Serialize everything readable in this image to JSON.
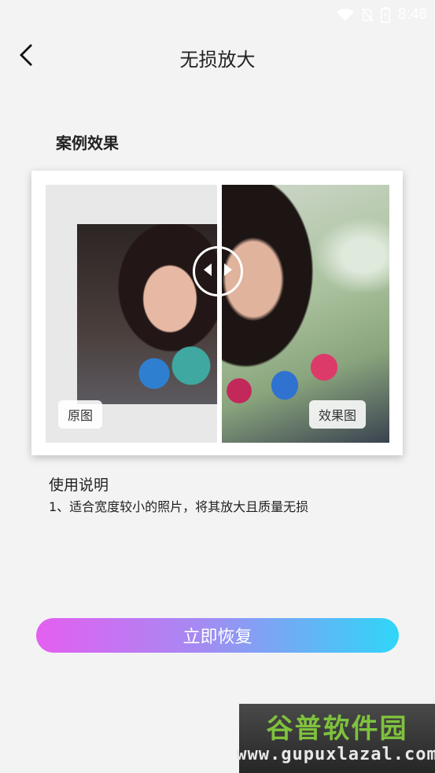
{
  "status_bar": {
    "time": "8:46",
    "icons": [
      "wifi-icon",
      "no-sim-icon",
      "battery-icon"
    ]
  },
  "header": {
    "title": "无损放大",
    "back_icon": "chevron-left-icon"
  },
  "example": {
    "section_title": "案例效果",
    "before_label": "原图",
    "after_label": "效果图",
    "handle_icon": "compare-arrows-icon"
  },
  "usage": {
    "title": "使用说明",
    "text": "1、适合宽度较小的照片，将其放大且质量无损"
  },
  "action": {
    "restore_label": "立即恢复"
  },
  "watermark": {
    "brand": "谷普软件园",
    "url": "www.gupuxlazal.com"
  },
  "colors": {
    "gradient_start": "#e45ff0",
    "gradient_end": "#2fd6f8",
    "background": "#f3f3f3"
  }
}
